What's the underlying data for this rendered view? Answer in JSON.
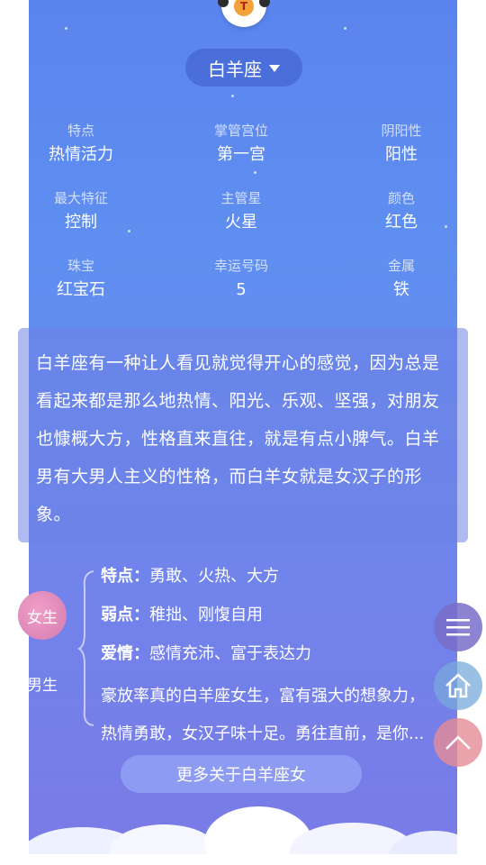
{
  "sign_selector": {
    "label": "白羊座"
  },
  "mascot": {
    "letter": "T"
  },
  "attributes": [
    {
      "key": "特点",
      "value": "热情活力"
    },
    {
      "key": "掌管宫位",
      "value": "第一宫"
    },
    {
      "key": "阴阳性",
      "value": "阳性"
    },
    {
      "key": "最大特征",
      "value": "控制"
    },
    {
      "key": "主管星",
      "value": "火星"
    },
    {
      "key": "颜色",
      "value": "红色"
    },
    {
      "key": "珠宝",
      "value": "红宝石"
    },
    {
      "key": "幸运号码",
      "value": "5"
    },
    {
      "key": "金属",
      "value": "铁"
    }
  ],
  "description": "白羊座有一种让人看见就觉得开心的感觉，因为总是看起来都是那么地热情、阳光、乐观、坚强，对朋友也慷概大方，性格直来直往，就是有点小脾气。白羊男有大男人主义的性格，而白羊女就是女汉子的形象。",
  "gender_tabs": {
    "female": "女生",
    "male": "男生"
  },
  "female_traits": {
    "features_label": "特点：",
    "features": "勇敢、火热、大方",
    "weakness_label": "弱点：",
    "weakness": "稚拙、刚愎自用",
    "love_label": "爱情：",
    "love": "感情充沛、富于表达力",
    "summary_line1": "豪放率真的白羊座女生，富有强大的想象力，",
    "summary_line2": "热情勇敢，女汉子味十足。勇往直前，是你..."
  },
  "more_button": "更多关于白羊座女",
  "colors": {
    "panel_top": "#5b84ee",
    "panel_bottom": "#7a7ae6",
    "female_badge": "#e08cbd"
  },
  "icons": {
    "menu": "menu-icon",
    "home": "home-icon",
    "top": "chevron-up-icon"
  }
}
